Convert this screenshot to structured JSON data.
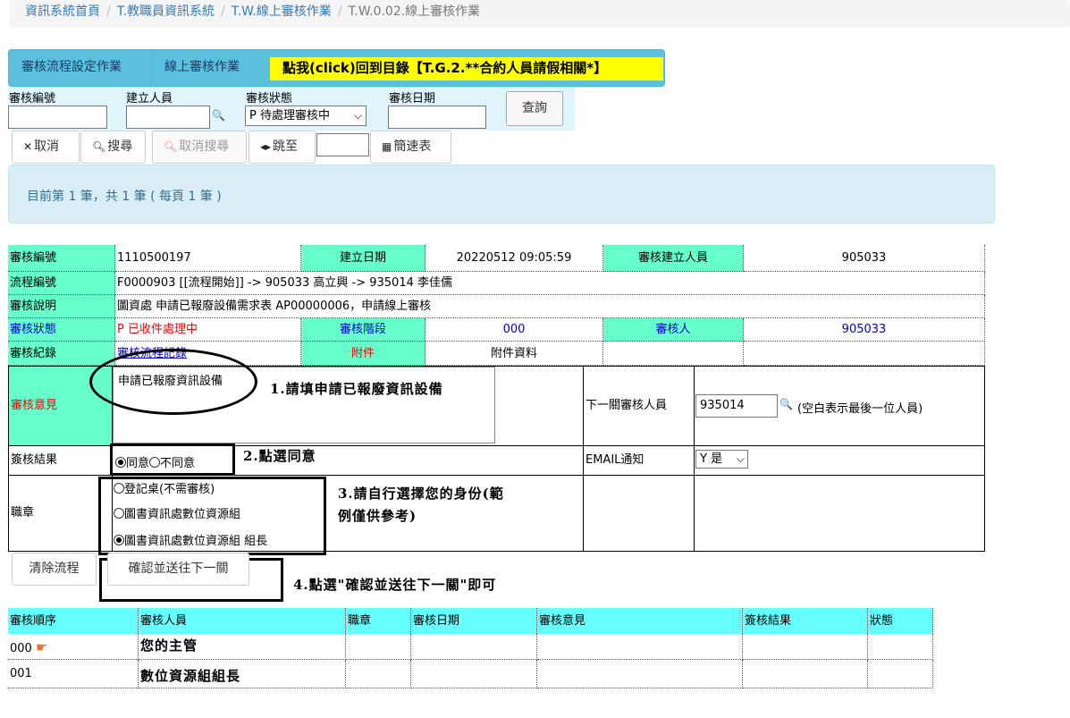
{
  "breadcrumb": [
    "資訊系統首頁",
    "T.教職員資訊系統",
    "T.W.線上審核作業",
    "T.W.0.02.線上審核作業"
  ],
  "tabs": {
    "tab1": "審核流程設定作業",
    "tab2": "線上審核作業",
    "back_link": "點我(click)回到目錄【T.G.2.**合約人員請假相關*】"
  },
  "search": {
    "audit_no_label": "審核編號",
    "creator_label": "建立人員",
    "status_label": "審核狀態",
    "status_value": "P 待處理審核中",
    "date_label": "審核日期",
    "query_button": "查詢"
  },
  "toolbar": {
    "cancel": "取消",
    "search": "搜尋",
    "cancel_search": "取消搜尋",
    "jump": "跳至",
    "quick_table": "簡速表"
  },
  "info_text": "目前第 1 筆，共 1 筆 ( 每頁 1 筆 )",
  "detail": {
    "audit_no_label": "審核編號",
    "audit_no": "1110500197",
    "created_date_label": "建立日期",
    "created_date": "20220512 09:05:59",
    "creator_label": "審核建立人員",
    "creator": "905033",
    "flow_no_label": "流程編號",
    "flow_no": "F0000903 [[流程開始]] -> 905033 高立興 -> 935014 李佳儒",
    "desc_label": "審核說明",
    "desc": "圖資處 申請已報廢設備需求表 AP00000006，申請線上審核",
    "status_label": "審核狀態",
    "status_code": "P",
    "status_text": "已收件處理中",
    "stage_label": "審核階段",
    "stage": "000",
    "auditor_label": "審核人",
    "auditor": "905033",
    "record_label": "審核紀錄",
    "record_link": "審核流程記錄",
    "attach_label": "附件",
    "attach_data": "附件資料",
    "opinion_label": "審核意見",
    "opinion_value": "申請已報廢資訊設備",
    "next_label": "下一關審核人員",
    "next_value": "935014",
    "next_hint": "(空白表示最後一位人員)",
    "result_label": "簽核結果",
    "agree": "同意",
    "disagree": "不同意",
    "email_label": "EMAIL通知",
    "email_value": "Y 是",
    "seal_label": "職章",
    "seals": [
      "登記桌(不需審核)",
      "圖書資訊處數位資源組",
      "圖書資訊處數位資源組 組長"
    ]
  },
  "annotations": {
    "n1": "1.請填申請已報廢資訊設備",
    "n2": "2.點選同意",
    "n3a": "3.請自行選擇您的身份(範",
    "n3b": "例僅供參考)",
    "n4": "4.點選\"確認並送往下一關\"即可"
  },
  "actions": {
    "clear_flow": "清除流程",
    "confirm_next": "確認並送往下一關"
  },
  "history": {
    "headers": [
      "審核順序",
      "審核人員",
      "職章",
      "審核日期",
      "審核意見",
      "簽核結果",
      "狀態"
    ],
    "rows": [
      {
        "order": "000",
        "person": "您的主管"
      },
      {
        "order": "001",
        "person": "數位資源組組長"
      }
    ]
  }
}
